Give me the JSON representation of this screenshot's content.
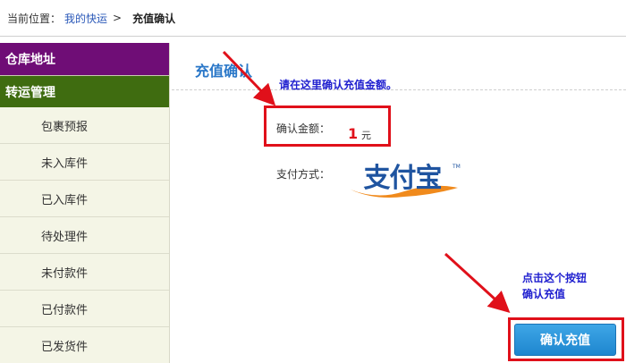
{
  "breadcrumb": {
    "label": "当前位置：",
    "link": "我的快运",
    "separator": ">",
    "current": "充值确认"
  },
  "sidebar": {
    "sections": [
      {
        "title": "仓库地址",
        "color": "#6f0d76"
      },
      {
        "title": "转运管理",
        "color": "#3f6c10"
      }
    ],
    "items": [
      "包裹预报",
      "未入库件",
      "已入库件",
      "待处理件",
      "未付款件",
      "已付款件",
      "已发货件"
    ]
  },
  "main": {
    "title": "充值确认",
    "amount_label": "确认金额：",
    "amount_value": "1",
    "amount_unit": "元",
    "payment_label": "支付方式：",
    "payment_logo": "支付宝",
    "payment_logo_mark": "TM",
    "confirm_button": "确认充值"
  },
  "annotations": {
    "amount_hint": "请在这里确认充值金额。",
    "button_hint_line1": "点击这个按钮",
    "button_hint_line2": "确认充值"
  },
  "colors": {
    "accent_blue": "#2a77c8",
    "highlight_red": "#e0101a",
    "annotation_blue": "#1f1fcf",
    "alipay_blue": "#1f54a0",
    "alipay_orange": "#f08a1c"
  }
}
